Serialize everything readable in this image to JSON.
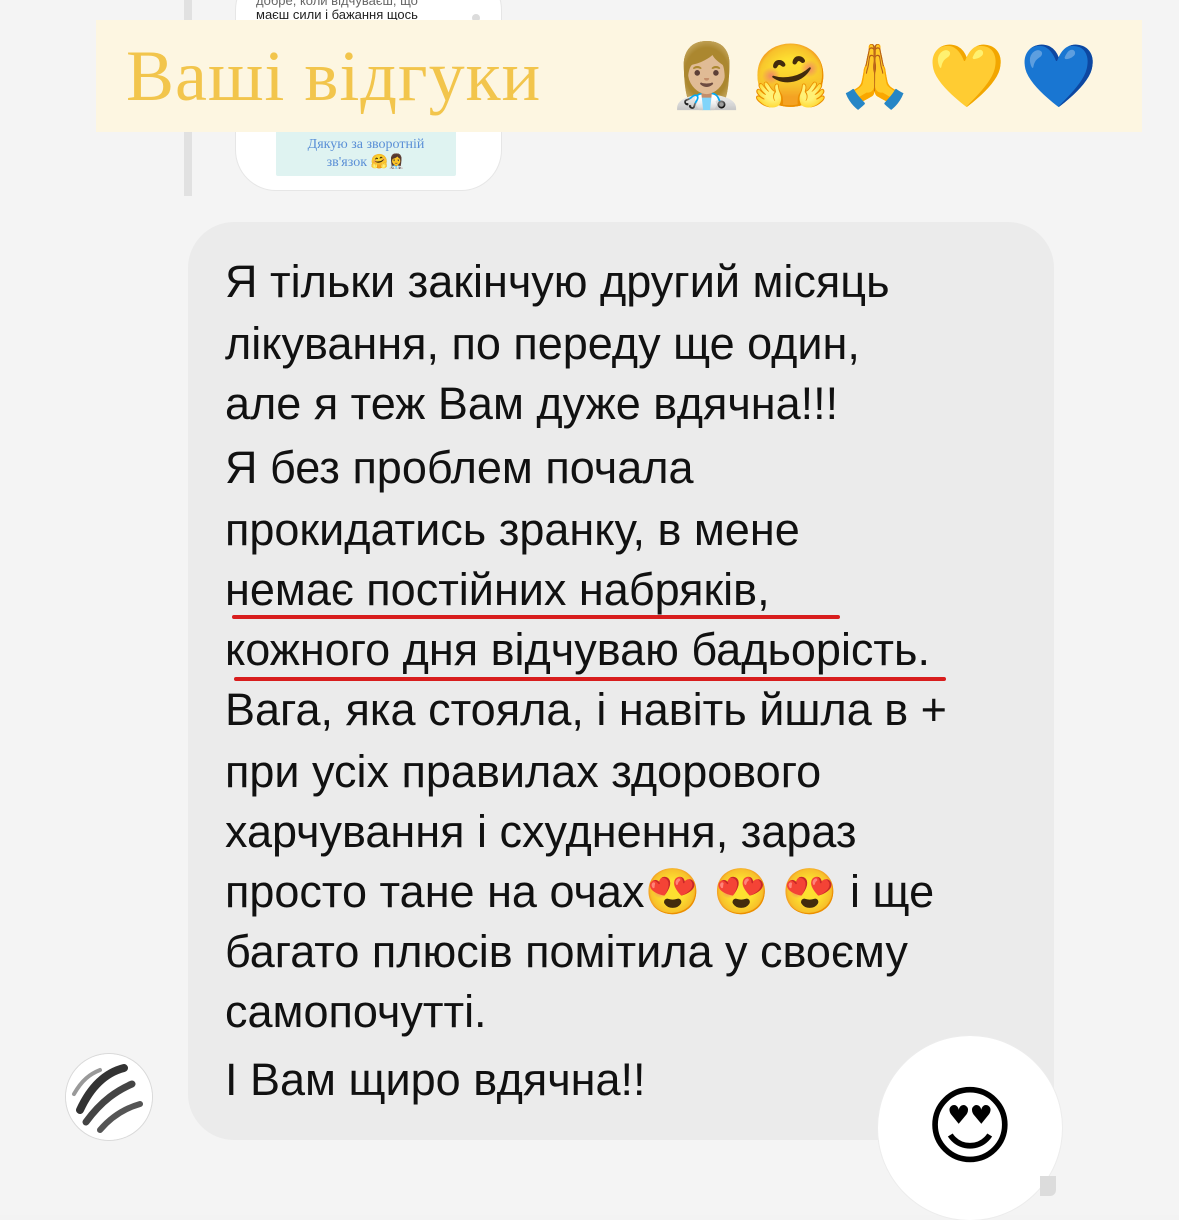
{
  "previous_message": {
    "text_line1": "добре, коли відчуваєш, що",
    "text_line2": "маєш сили і бажання щось",
    "image_caption_line1": "Дякую за зворотній",
    "image_caption_line2": "зв'язок 🤗👩‍⚕️"
  },
  "banner": {
    "title": "Ваші відгуки",
    "emojis": [
      "👩🏼‍⚕️",
      "🤗",
      "🙏",
      "💛",
      "💙"
    ]
  },
  "message": {
    "lines": [
      "Я тільки закінчую другий місяць",
      "лікування, по переду ще один,",
      "але я теж Вам дуже вдячна!!!",
      "Я без проблем почала",
      "прокидатись зранку, в мене",
      "немає постійних набряків,",
      "кожного дня відчуваю бадьорість.",
      "Вага, яка стояла, і навіть йшла в +",
      "при усіх правилах здорового",
      "харчування і схуднення, зараз",
      "просто тане на очах😍 😍 😍  і ще",
      "багато плюсів помітила у своєму",
      "самопочутті.",
      "І Вам щиро вдячна!!"
    ]
  },
  "reaction": {
    "emoji": "😍"
  },
  "colors": {
    "banner_title": "#f2c54c",
    "banner_bg": "#fdf6e1",
    "bubble_bg": "#ebebeb",
    "underline": "#d81d1d"
  },
  "icons": {
    "avatar": "user-avatar-icon"
  }
}
